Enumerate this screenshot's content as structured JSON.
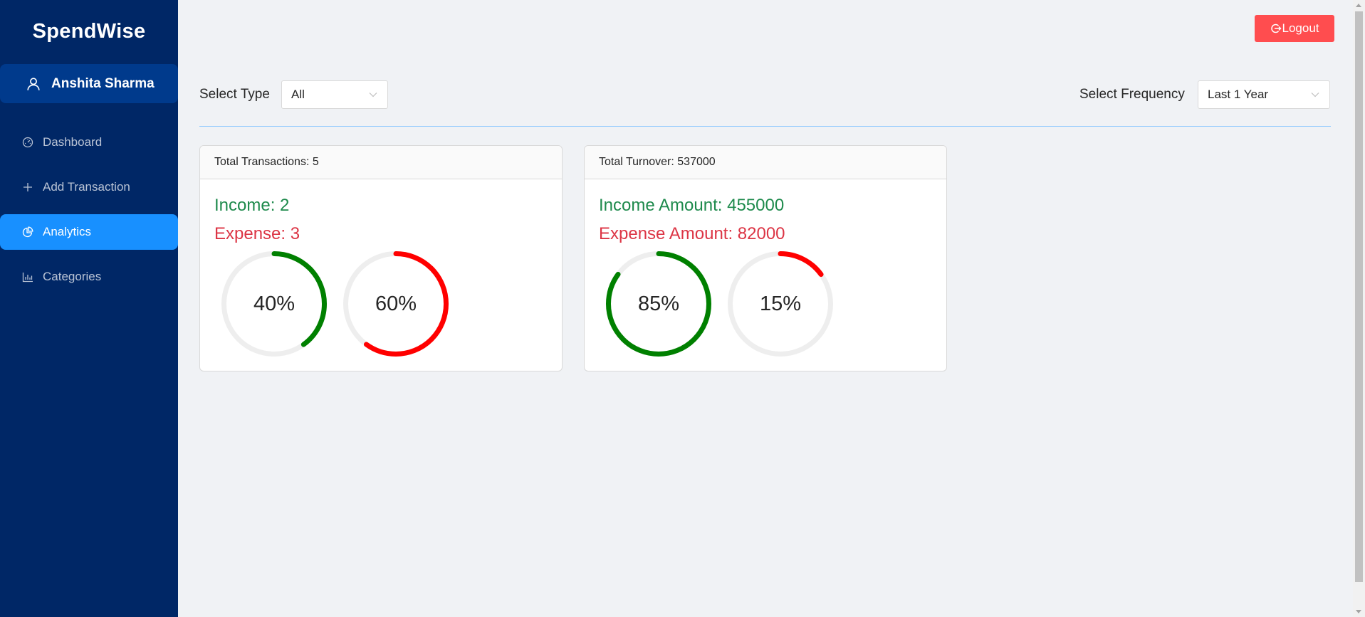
{
  "app": {
    "title": "SpendWise"
  },
  "user": {
    "name": "Anshita Sharma",
    "icon": "user-icon"
  },
  "menu": [
    {
      "label": "Dashboard",
      "icon": "dashboard-icon",
      "active": false
    },
    {
      "label": "Add Transaction",
      "icon": "plus-icon",
      "active": false
    },
    {
      "label": "Analytics",
      "icon": "pie-chart-icon",
      "active": true
    },
    {
      "label": "Categories",
      "icon": "bar-chart-icon",
      "active": false
    }
  ],
  "header": {
    "logout_label": "Logout",
    "logout_icon": "logout-icon"
  },
  "filters": {
    "type_label": "Select Type",
    "type_value": "All",
    "frequency_label": "Select Frequency",
    "frequency_value": "Last 1 Year"
  },
  "colors": {
    "sidebar": "#002766",
    "active": "#1890ff",
    "income": "#008000",
    "expense": "#ff0000",
    "track": "#eeeeee",
    "logout": "#ff4d4f"
  },
  "cards": [
    {
      "header": "Total Transactions: 5",
      "income_text": "Income: 2",
      "expense_text": "Expense: 3",
      "rings": [
        {
          "percent": 40,
          "label": "40%",
          "kind": "income"
        },
        {
          "percent": 60,
          "label": "60%",
          "kind": "expense"
        }
      ]
    },
    {
      "header": "Total Turnover: 537000",
      "income_text": "Income Amount: 455000",
      "expense_text": "Expense Amount: 82000",
      "rings": [
        {
          "percent": 85,
          "label": "85%",
          "kind": "income"
        },
        {
          "percent": 15,
          "label": "15%",
          "kind": "expense"
        }
      ]
    }
  ]
}
